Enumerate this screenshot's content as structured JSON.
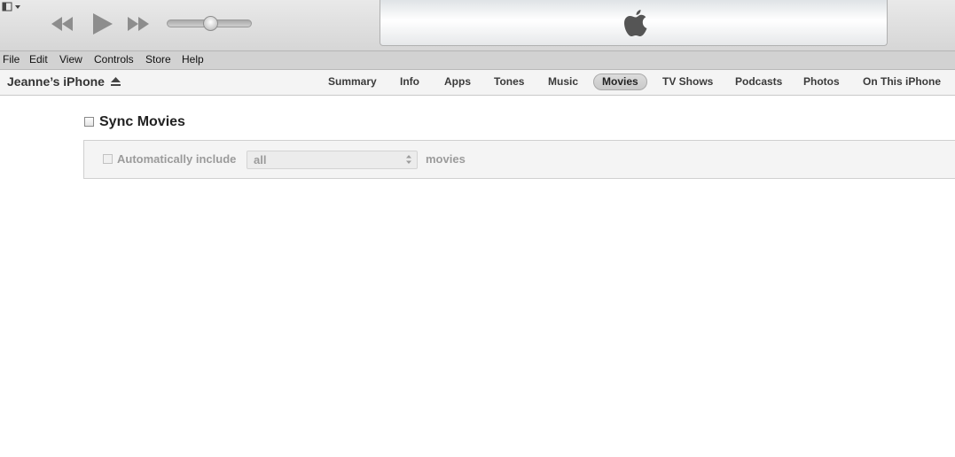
{
  "toolbar": {
    "icons": [
      "window-menu-icon",
      "rewind-icon",
      "play-icon",
      "fast-forward-icon",
      "apple-logo-icon"
    ],
    "volume_level": 0.5
  },
  "menu": {
    "items": [
      "File",
      "Edit",
      "View",
      "Controls",
      "Store",
      "Help"
    ]
  },
  "device": {
    "name": "Jeanne’s iPhone",
    "tabs": [
      "Summary",
      "Info",
      "Apps",
      "Tones",
      "Music",
      "Movies",
      "TV Shows",
      "Podcasts",
      "Photos",
      "On This iPhone"
    ],
    "selected_tab": "Movies"
  },
  "sync": {
    "title": "Sync Movies",
    "checked": false,
    "auto_include_label": "Automatically include",
    "auto_include_checked": false,
    "selected_option": "all",
    "suffix_label": "movies"
  },
  "colors": {
    "toolbar": "#dedede",
    "menubar": "#d2d2d2",
    "selected_tab": "#cfcfcf",
    "disabled_text": "#9b9b9b"
  }
}
